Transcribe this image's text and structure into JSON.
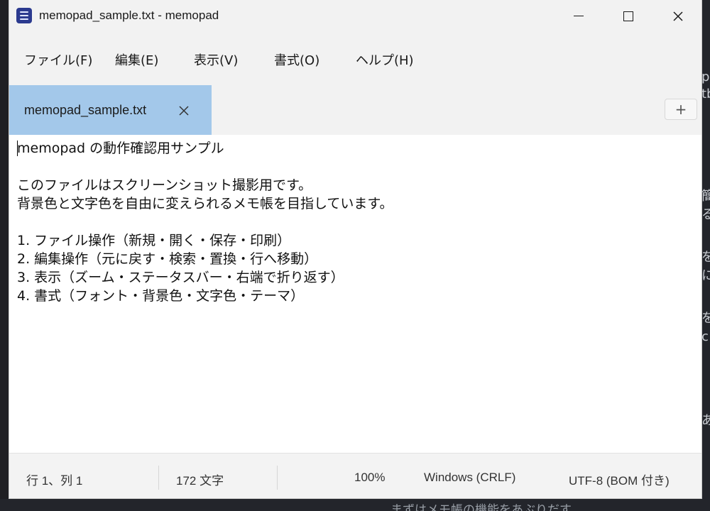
{
  "window": {
    "title": "memopad_sample.txt - memopad",
    "icon": "notepad-icon"
  },
  "menu": [
    {
      "label": "ファイル(F)"
    },
    {
      "label": "編集(E)"
    },
    {
      "label": "表示(V)"
    },
    {
      "label": "書式(O)"
    },
    {
      "label": "ヘルプ(H)"
    }
  ],
  "tabs": [
    {
      "label": "memopad_sample.txt",
      "active": true
    }
  ],
  "new_tab_label": "+",
  "editor": {
    "lines": [
      "memopad の動作確認用サンプル",
      "",
      "このファイルはスクリーンショット撮影用です。",
      "背景色と文字色を自由に変えられるメモ帳を目指しています。",
      "",
      "1. ファイル操作（新規・開く・保存・印刷）",
      "2. 編集操作（元に戻す・検索・置換・行へ移動）",
      "3. 表示（ズーム・ステータスバー・右端で折り返す）",
      "4. 書式（フォント・背景色・文字色・テーマ）"
    ]
  },
  "status": {
    "position": "行 1、列 1",
    "chars": "172 文字",
    "zoom": "100%",
    "line_ending": "Windows (CRLF)",
    "encoding": "UTF-8 (BOM 付き)"
  },
  "colors": {
    "active_tab": "#a3c8ea",
    "chrome": "#f2f2f2",
    "editor_bg": "#ffffff",
    "text": "#111111"
  }
}
